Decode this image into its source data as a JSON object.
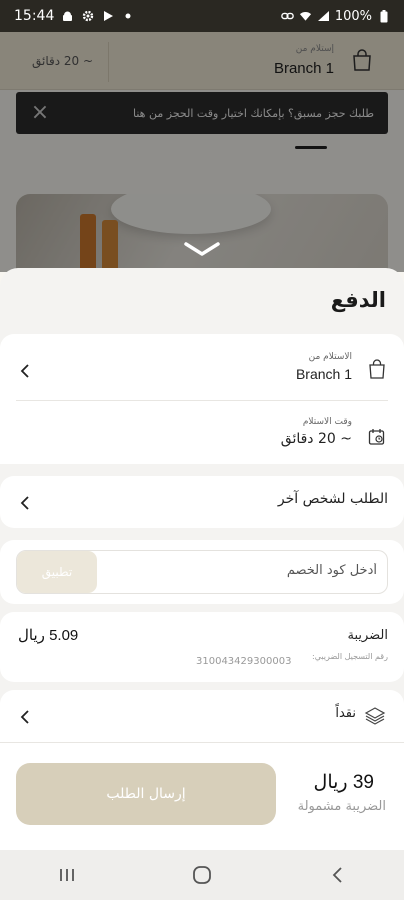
{
  "status_bar": {
    "time": "15:44",
    "battery": "100%"
  },
  "background": {
    "header": {
      "time_est": "~ 20 دقائق",
      "branch_label": "إستلام من",
      "branch_name": "Branch 1"
    },
    "toast": {
      "message": "طلبك حجز مسبق؟ بإمكانك اختيار وقت الحجز من هنا"
    }
  },
  "sheet": {
    "title": "الدفع",
    "pickup": {
      "label": "الاستلام من",
      "value": "Branch 1"
    },
    "time": {
      "label": "وقت الاستلام",
      "value": "~ 20 دقائق"
    },
    "order_for_other": {
      "label": "الطلب لشخص آخر"
    },
    "promo": {
      "placeholder": "أدخل كود الخصم",
      "apply_label": "تطبيق"
    },
    "tax": {
      "label": "الضريبة",
      "amount": "5.09 ريال",
      "reg_label": "رقم التسجيل الضريبي:",
      "reg_number": "310043429300003"
    },
    "payment": {
      "method": "نقداً"
    },
    "footer": {
      "total": "39 ريال",
      "tax_note": "الضريبة مشمولة",
      "submit_label": "إرسال الطلب"
    }
  }
}
